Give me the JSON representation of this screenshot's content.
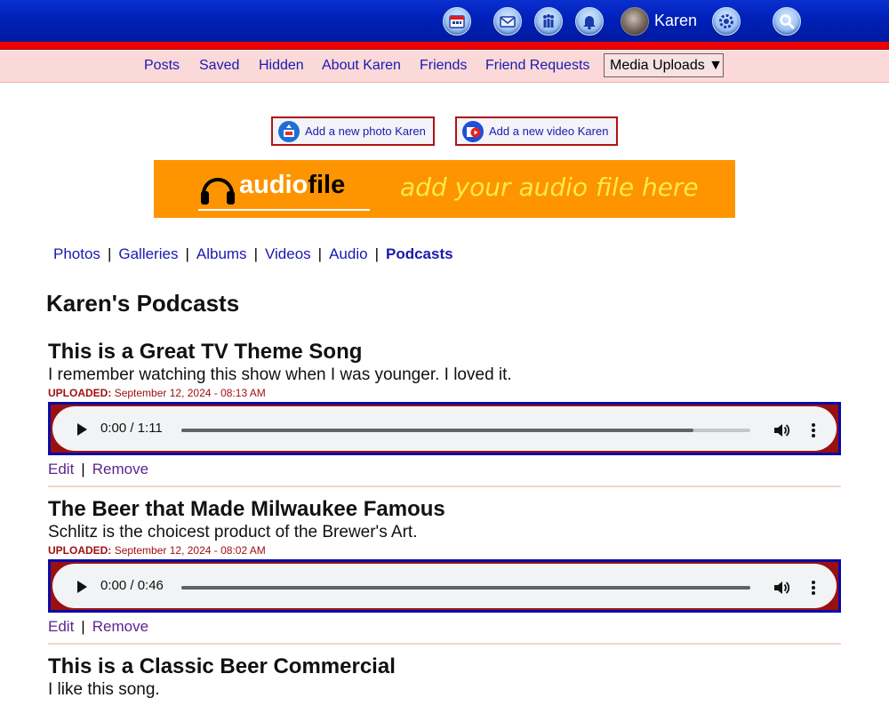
{
  "header": {
    "username": "Karen",
    "icons": [
      "calendar-icon",
      "mail-icon",
      "groups-icon",
      "bell-icon",
      "settings-icon",
      "search-icon"
    ]
  },
  "nav": {
    "items": [
      "Posts",
      "Saved",
      "Hidden",
      "About Karen",
      "Friends",
      "Friend Requests"
    ],
    "media_uploads": "Media Uploads ▼"
  },
  "actions": {
    "add_photo": "Add a new photo Karen",
    "add_video": "Add a new video Karen"
  },
  "banner": {
    "brand_audio": "audio",
    "brand_file": "file",
    "tagline": "add your audio file here"
  },
  "subnav": {
    "items": [
      "Photos",
      "Galleries",
      "Albums",
      "Videos",
      "Audio",
      "Podcasts"
    ],
    "active": "Podcasts"
  },
  "page_title": "Karen's Podcasts",
  "labels": {
    "uploaded": "UPLOADED:",
    "edit": "Edit",
    "remove": "Remove"
  },
  "podcasts": [
    {
      "title": "This is a Great TV Theme Song",
      "description": "I remember watching this show when I was younger. I loved it.",
      "uploaded": "September 12, 2024 - 08:13 AM",
      "time": "0:00 / 1:11",
      "buffered_fraction": 0.9
    },
    {
      "title": "The Beer that Made Milwaukee Famous",
      "description": "Schlitz is the choicest product of the Brewer's Art.",
      "uploaded": "September 12, 2024 - 08:02 AM",
      "time": "0:00 / 0:46",
      "buffered_fraction": 1.0
    },
    {
      "title": "This is a Classic Beer Commercial",
      "description": "I like this song."
    }
  ],
  "colors": {
    "header_blue": "#0020b8",
    "header_red": "#ee0000",
    "nav_bg": "#fcd9d9",
    "link": "#1a1ab0",
    "banner": "#fe9400",
    "uploaded": "#a01010"
  }
}
